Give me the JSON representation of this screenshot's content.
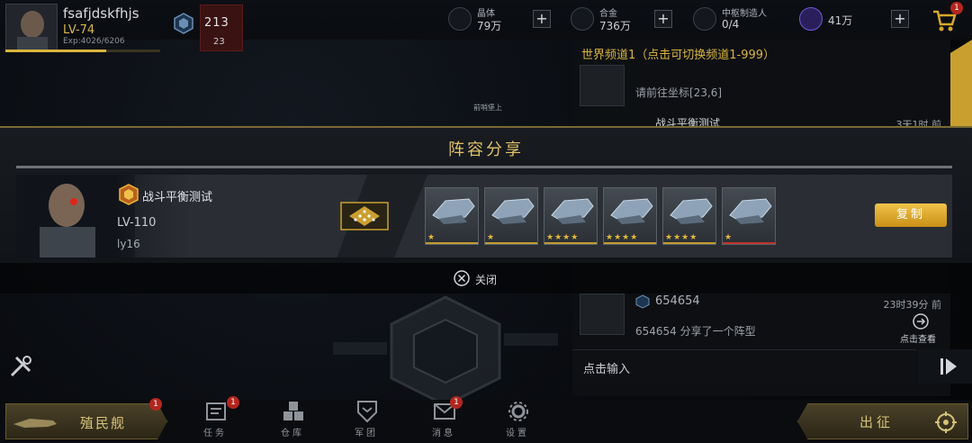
{
  "player": {
    "name": "fsafjdskfhjs",
    "level": "LV-74",
    "exp": "Exp:4026/6206",
    "exp_fraction": 0.649,
    "rank_digits": "213",
    "rank_value": "23"
  },
  "resources": [
    {
      "label": "晶体",
      "value": "79万",
      "icon": "crystal-icon"
    },
    {
      "label": "合金",
      "value": "736万",
      "icon": "alloy-icon"
    },
    {
      "label": "中枢制造人",
      "value": "0/4",
      "icon": "worker-icon"
    },
    {
      "label": "",
      "value": "41万",
      "icon": "u-currency-icon"
    }
  ],
  "cart_badge": "1",
  "chat": {
    "channel": "世界频道1（点击可切换频道1-999）",
    "messages": [
      {
        "text": "请前往坐标[23,6]",
        "time": ""
      },
      {
        "name": "战斗平衡测试",
        "time": "3天1时 前"
      },
      {
        "name": "654654",
        "text": "654654 分享了一个阵型",
        "time": "23时39分 前",
        "action": "点击查看"
      }
    ],
    "input_placeholder": "点击输入"
  },
  "modal": {
    "title": "阵容分享",
    "commander_name": "战斗平衡测试",
    "commander_level": "LV-110",
    "commander_user": "ly16",
    "copy_label": "复制",
    "close_label": "关闭",
    "ships": [
      {
        "stars": "★",
        "rarity": "gold"
      },
      {
        "stars": "★",
        "rarity": "gold"
      },
      {
        "stars": "★★★★",
        "rarity": "gold"
      },
      {
        "stars": "★★★★",
        "rarity": "gold"
      },
      {
        "stars": "★★★★",
        "rarity": "gold"
      },
      {
        "stars": "★",
        "rarity": "red"
      }
    ]
  },
  "map_labels": {
    "label_a": "前哨堡上"
  },
  "bottom": {
    "colony_label": "殖民舰",
    "colony_badge": "1",
    "nav": [
      {
        "label": "任务",
        "icon": "mission-icon",
        "badge": "1"
      },
      {
        "label": "仓库",
        "icon": "warehouse-icon",
        "badge": ""
      },
      {
        "label": "军团",
        "icon": "legion-icon",
        "badge": ""
      },
      {
        "label": "消息",
        "icon": "message-icon",
        "badge": "1"
      },
      {
        "label": "设置",
        "icon": "settings-icon",
        "badge": ""
      }
    ],
    "go_label": "出征"
  },
  "colors": {
    "accent_gold": "#d9b53f",
    "alert_red": "#b3261e"
  }
}
